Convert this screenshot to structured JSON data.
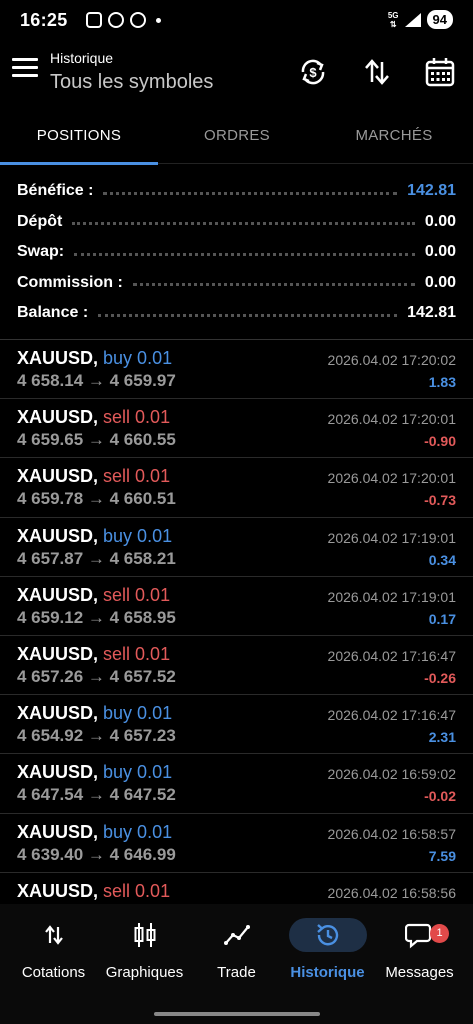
{
  "status_bar": {
    "time": "16:25",
    "network": "5G",
    "battery": "94"
  },
  "header": {
    "title": "Historique",
    "subtitle": "Tous les symboles"
  },
  "tabs": [
    {
      "label": "POSITIONS",
      "active": true
    },
    {
      "label": "ORDRES",
      "active": false
    },
    {
      "label": "MARCHÉS",
      "active": false
    }
  ],
  "summary": [
    {
      "label": "Bénéfice :",
      "value": "142.81",
      "accent": "#4a90e2"
    },
    {
      "label": "Dépôt",
      "value": "0.00"
    },
    {
      "label": "Swap:",
      "value": "0.00"
    },
    {
      "label": "Commission :",
      "value": "0.00"
    },
    {
      "label": "Balance :",
      "value": "142.81"
    }
  ],
  "deals": [
    {
      "symbol": "XAUUSD,",
      "side": "buy 0.01",
      "type": "buy",
      "prices": "4 658.14 → 4 659.97",
      "time": "2026.04.02 17:20:02",
      "profit": "1.83"
    },
    {
      "symbol": "XAUUSD,",
      "side": "sell 0.01",
      "type": "sell",
      "prices": "4 659.65 → 4 660.55",
      "time": "2026.04.02 17:20:01",
      "profit": "-0.90"
    },
    {
      "symbol": "XAUUSD,",
      "side": "sell 0.01",
      "type": "sell",
      "prices": "4 659.78 → 4 660.51",
      "time": "2026.04.02 17:20:01",
      "profit": "-0.73"
    },
    {
      "symbol": "XAUUSD,",
      "side": "buy 0.01",
      "type": "buy",
      "prices": "4 657.87 → 4 658.21",
      "time": "2026.04.02 17:19:01",
      "profit": "0.34"
    },
    {
      "symbol": "XAUUSD,",
      "side": "sell 0.01",
      "type": "sell",
      "prices": "4 659.12 → 4 658.95",
      "time": "2026.04.02 17:19:01",
      "profit": "0.17"
    },
    {
      "symbol": "XAUUSD,",
      "side": "sell 0.01",
      "type": "sell",
      "prices": "4 657.26 → 4 657.52",
      "time": "2026.04.02 17:16:47",
      "profit": "-0.26"
    },
    {
      "symbol": "XAUUSD,",
      "side": "buy 0.01",
      "type": "buy",
      "prices": "4 654.92 → 4 657.23",
      "time": "2026.04.02 17:16:47",
      "profit": "2.31"
    },
    {
      "symbol": "XAUUSD,",
      "side": "buy 0.01",
      "type": "buy",
      "prices": "4 647.54 → 4 647.52",
      "time": "2026.04.02 16:59:02",
      "profit": "-0.02"
    },
    {
      "symbol": "XAUUSD,",
      "side": "buy 0.01",
      "type": "buy",
      "prices": "4 639.40 → 4 646.99",
      "time": "2026.04.02 16:58:57",
      "profit": "7.59"
    },
    {
      "symbol": "XAUUSD,",
      "side": "sell 0.01",
      "type": "sell",
      "prices": "",
      "time": "2026.04.02 16:58:56",
      "profit": ""
    }
  ],
  "bottom_nav": [
    {
      "label": "Cotations",
      "icon": "arrows-updown-icon",
      "active": false
    },
    {
      "label": "Graphiques",
      "icon": "candlestick-icon",
      "active": false
    },
    {
      "label": "Trade",
      "icon": "trend-line-icon",
      "active": false
    },
    {
      "label": "Historique",
      "icon": "history-icon",
      "active": true
    },
    {
      "label": "Messages",
      "icon": "chat-icon",
      "active": false,
      "badge": "1"
    }
  ],
  "colors": {
    "accent": "#4a90e2",
    "loss": "#e25a5a",
    "background": "#000000"
  }
}
